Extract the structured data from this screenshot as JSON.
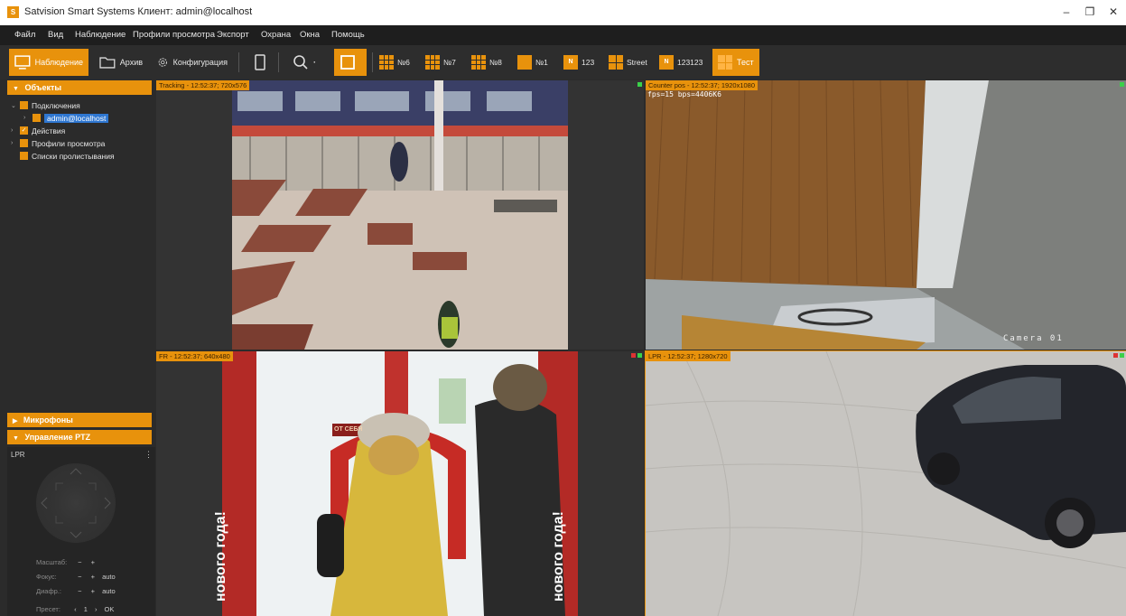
{
  "window": {
    "title": "Satvision Smart Systems Клиент: admin@localhost",
    "app_icon": "app-logo-icon",
    "minimize": "–",
    "restore": "❐",
    "close": "✕"
  },
  "menu": [
    "Файл",
    "Вид",
    "Наблюдение",
    "Профили просмотра",
    "Экспорт",
    "Охрана",
    "Окна",
    "Помощь"
  ],
  "toolbar": {
    "observe": "Наблюдение",
    "archive": "Архив",
    "config": "Конфигурация",
    "search_dropdown": "·",
    "layouts": [
      {
        "label": "№6",
        "icon": "grid-3x3-icon"
      },
      {
        "label": "№7",
        "icon": "grid-3x3-icon"
      },
      {
        "label": "№8",
        "icon": "grid-3x3-icon"
      },
      {
        "label": "№1",
        "icon": "single-view-icon"
      },
      {
        "label": "123",
        "icon": "single-view-icon",
        "badge": "N"
      },
      {
        "label": "Street",
        "icon": "grid-2x2-icon"
      },
      {
        "label": "123123",
        "icon": "single-view-icon",
        "badge": "N"
      },
      {
        "label": "Тест",
        "icon": "grid-2x2-icon"
      }
    ]
  },
  "left_panel": {
    "objects_header": "Объекты",
    "tree": {
      "connections": "Подключения",
      "connection_item": "admin@localhost",
      "actions": "Действия",
      "view_profiles": "Профили просмотра",
      "playlists": "Списки пролистывания"
    },
    "microphones_header": "Микрофоны",
    "ptz_header": "Управление PTZ",
    "ptz": {
      "camera": "LPR",
      "menu": "⋮",
      "zoom_label": "Масштаб:",
      "focus_label": "Фокус:",
      "iris_label": "Диафр.:",
      "preset_label": "Пресет:",
      "minus": "−",
      "plus": "+",
      "auto": "auto",
      "preset_prev": "‹",
      "preset_value": "1",
      "preset_next": "›",
      "ok": "OK"
    }
  },
  "cameras": [
    {
      "label": "Tracking - 12:52:37; 720x576"
    },
    {
      "label": "Counter pos - 12:52:37; 1920x1080",
      "overlay_top": "fps=15 bps=4406K6",
      "overlay_bottom": "Camera 01"
    },
    {
      "label": "FR - 12:52:37; 640x480",
      "sign_left": "нового года!",
      "sign_right": "нового года!",
      "door_sign": "ОТ СЕБЯ"
    },
    {
      "label": "LPR - 12:52:37; 1280x720"
    }
  ],
  "colors": {
    "accent": "#e8920c",
    "background": "#2b2b2b",
    "selection": "#2f77d1"
  }
}
